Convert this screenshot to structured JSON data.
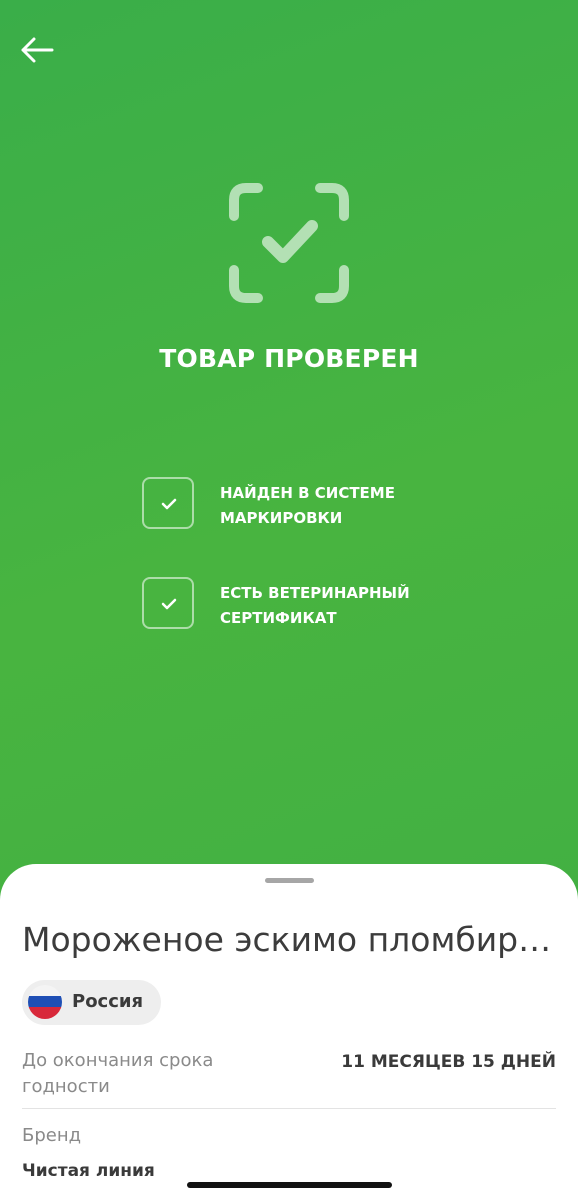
{
  "header": {
    "back_icon": "arrow-left-icon"
  },
  "status": {
    "icon": "scan-check-icon",
    "title": "ТОВАР ПРОВЕРЕН"
  },
  "checks": [
    {
      "line1": "НАЙДЕН В СИСТЕМЕ",
      "line2": "МАРКИРОВКИ",
      "icon": "check-icon"
    },
    {
      "line1": "ЕСТЬ ВЕТЕРИНАРНЫЙ",
      "line2": "СЕРТИФИКАТ",
      "icon": "check-icon"
    }
  ],
  "product": {
    "name": "Мороженое эскимо пломбир…",
    "country": "Россия",
    "country_icon": "russia-flag-icon",
    "shelf_life_label_line1": "До окончания срока",
    "shelf_life_label_line2": "годности",
    "shelf_life_value": "11 МЕСЯЦЕВ 15 ДНЕЙ",
    "brand_label": "Бренд",
    "brand_value": "Чистая линия"
  },
  "colors": {
    "background_green": "#45b243",
    "sheet": "#ffffff",
    "chip": "#eeeeee"
  }
}
